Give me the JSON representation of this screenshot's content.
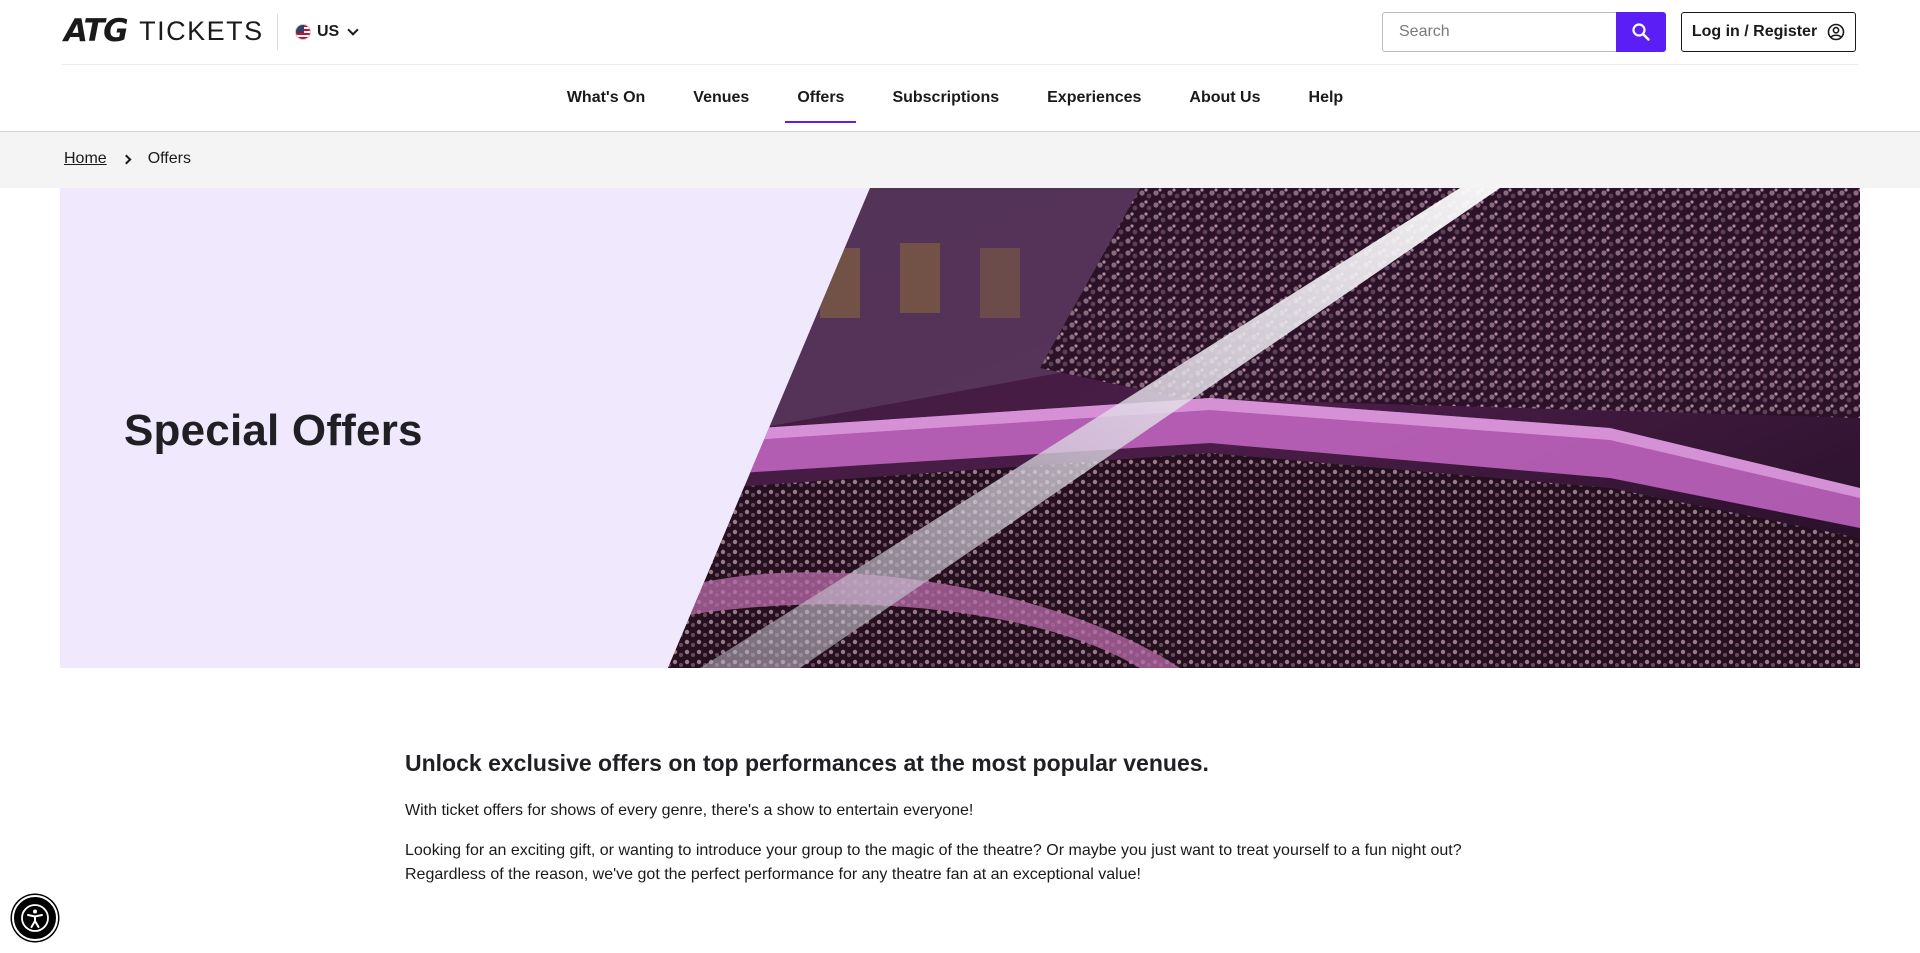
{
  "header": {
    "logo_mark": "ATG",
    "logo_text": "TICKETS",
    "locale": "US",
    "search_placeholder": "Search",
    "login_label": "Log in / Register"
  },
  "nav": {
    "items": [
      {
        "label": "What's On"
      },
      {
        "label": "Venues"
      },
      {
        "label": "Offers",
        "active": true
      },
      {
        "label": "Subscriptions"
      },
      {
        "label": "Experiences"
      },
      {
        "label": "About Us"
      },
      {
        "label": "Help"
      }
    ]
  },
  "breadcrumb": {
    "home": "Home",
    "current": "Offers"
  },
  "hero": {
    "title": "Special Offers"
  },
  "intro": {
    "heading": "Unlock exclusive offers on top performances at the most popular venues.",
    "paragraph_1": "With ticket offers for shows of every genre, there's a show to entertain everyone!",
    "paragraph_2_line_1": "Looking for an exciting gift, or wanting to introduce your group to the magic of the theatre? Or maybe you just want to treat yourself to a fun night out?",
    "paragraph_2_line_2": "Regardless of the reason, we've got the perfect performance for any theatre fan at an exceptional value!"
  },
  "colors": {
    "accent": "#5b1ff5",
    "hero_bg": "#f0e9fd",
    "breadcrumb_bg": "#f4f4f4"
  },
  "icons": [
    "us-flag-icon",
    "chevron-down-icon",
    "search-icon",
    "user-circle-icon",
    "chevron-right-icon",
    "accessibility-icon"
  ]
}
